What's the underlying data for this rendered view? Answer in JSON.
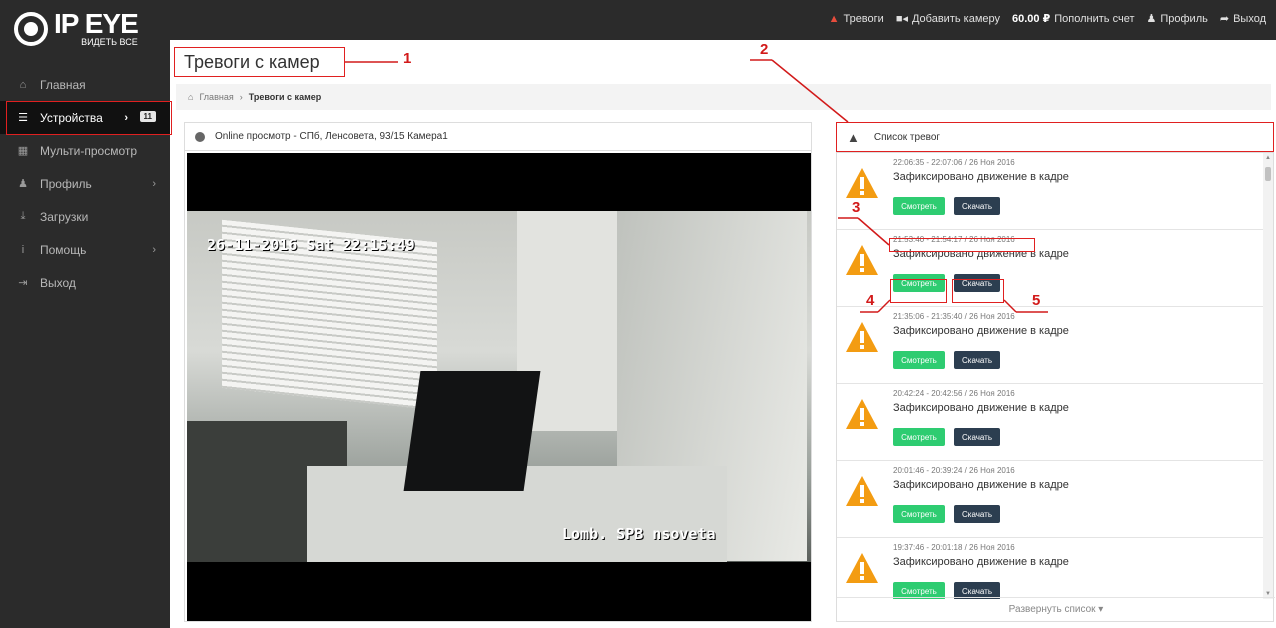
{
  "logo": {
    "brand": "IP EYE",
    "tagline": "ВИДЕТЬ ВСЕ"
  },
  "topnav": {
    "alarms": "Тревоги",
    "add_camera": "Добавить камеру",
    "balance": "60.00 ₽",
    "top_up": "Пополнить счет",
    "profile": "Профиль",
    "logout": "Выход"
  },
  "sidebar": {
    "items": [
      {
        "label": "Главная",
        "icon": "home-icon"
      },
      {
        "label": "Устройства",
        "icon": "list-icon",
        "badge": "11"
      },
      {
        "label": "Мульти-просмотр",
        "icon": "grid-icon"
      },
      {
        "label": "Профиль",
        "icon": "user-icon"
      },
      {
        "label": "Загрузки",
        "icon": "download-icon"
      },
      {
        "label": "Помощь",
        "icon": "info-icon"
      },
      {
        "label": "Выход",
        "icon": "logout-icon"
      }
    ]
  },
  "page": {
    "title": "Тревоги с камер",
    "breadcrumb_home": "Главная",
    "breadcrumb_current": "Тревоги с камер"
  },
  "video": {
    "header": "Online просмотр - СПб, Ленсовета, 93/15 Камера1",
    "timestamp": "26-11-2016 Sat 22:15:49",
    "overlay": "Lomb. SPB  nsoveta"
  },
  "alarms": {
    "header": "Список тревог",
    "view_label": "Смотреть",
    "download_label": "Скачать",
    "expand_label": "Развернуть список ▾",
    "items": [
      {
        "time": "22:06:35 - 22:07:06 / 26 Ноя 2016",
        "message": "Зафиксировано движение в кадре"
      },
      {
        "time": "21:53:40 - 21:54:17 / 26 Ноя 2016",
        "message": "Зафиксировано движение в кадре"
      },
      {
        "time": "21:35:06 - 21:35:40 / 26 Ноя 2016",
        "message": "Зафиксировано движение в кадре"
      },
      {
        "time": "20:42:24 - 20:42:56 / 26 Ноя 2016",
        "message": "Зафиксировано движение в кадре"
      },
      {
        "time": "20:01:46 - 20:39:24 / 26 Ноя 2016",
        "message": "Зафиксировано движение в кадре"
      },
      {
        "time": "19:37:46 - 20:01:18 / 26 Ноя 2016",
        "message": "Зафиксировано движение в кадре"
      }
    ]
  },
  "annotations": [
    "1",
    "2",
    "3",
    "4",
    "5"
  ],
  "colors": {
    "accent_red": "#e02020",
    "view_green": "#2ecc71",
    "download_navy": "#2c3e50",
    "warning_orange": "#f39c12",
    "topbar": "#2b2b2b"
  }
}
